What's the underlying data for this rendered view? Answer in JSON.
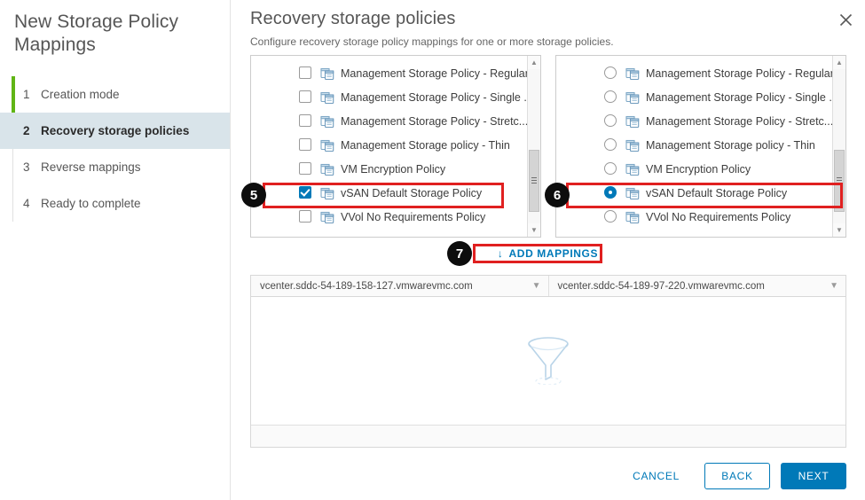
{
  "wizard": {
    "title": "New Storage Policy Mappings",
    "steps": [
      {
        "num": "1",
        "label": "Creation mode",
        "active": false
      },
      {
        "num": "2",
        "label": "Recovery storage policies",
        "active": true
      },
      {
        "num": "3",
        "label": "Reverse mappings",
        "active": false
      },
      {
        "num": "4",
        "label": "Ready to complete",
        "active": false
      }
    ]
  },
  "page": {
    "title": "Recovery storage policies",
    "subtitle": "Configure recovery storage policy mappings for one or more storage policies.",
    "close_icon": "close-icon"
  },
  "source_list": {
    "control_type": "checkbox",
    "items": [
      {
        "label": "Management Storage Policy - Regular",
        "selected": false
      },
      {
        "label": "Management Storage Policy - Single ...",
        "selected": false
      },
      {
        "label": "Management Storage Policy - Stretc...",
        "selected": false
      },
      {
        "label": "Management Storage policy - Thin",
        "selected": false
      },
      {
        "label": "VM Encryption Policy",
        "selected": false
      },
      {
        "label": "vSAN Default Storage Policy",
        "selected": true
      },
      {
        "label": "VVol No Requirements Policy",
        "selected": false
      }
    ]
  },
  "target_list": {
    "control_type": "radio",
    "items": [
      {
        "label": "Management Storage Policy - Regular",
        "selected": false
      },
      {
        "label": "Management Storage Policy - Single ...",
        "selected": false
      },
      {
        "label": "Management Storage Policy - Stretc...",
        "selected": false
      },
      {
        "label": "Management Storage policy - Thin",
        "selected": false
      },
      {
        "label": "VM Encryption Policy",
        "selected": false
      },
      {
        "label": "vSAN Default Storage Policy",
        "selected": true
      },
      {
        "label": "VVol No Requirements Policy",
        "selected": false
      }
    ]
  },
  "annotations": {
    "badge_source": "5",
    "badge_target": "6",
    "badge_add": "7",
    "highlight_color": "#e02020"
  },
  "add_mappings": {
    "label": "ADD MAPPINGS",
    "icon": "arrow-down-icon"
  },
  "mappings_table": {
    "columns": [
      {
        "header": "vcenter.sddc-54-189-158-127.vmwarevmc.com",
        "filter_icon": "filter-icon"
      },
      {
        "header": "vcenter.sddc-54-189-97-220.vmwarevmc.com",
        "filter_icon": "filter-icon"
      }
    ],
    "rows": [],
    "empty_icon": "funnel-icon"
  },
  "footer": {
    "cancel": "CANCEL",
    "back": "BACK",
    "next": "NEXT"
  },
  "colors": {
    "accent": "#0079b8",
    "step_done": "#60b515",
    "active_step_bg": "#d9e4ea",
    "highlight": "#e02020"
  }
}
